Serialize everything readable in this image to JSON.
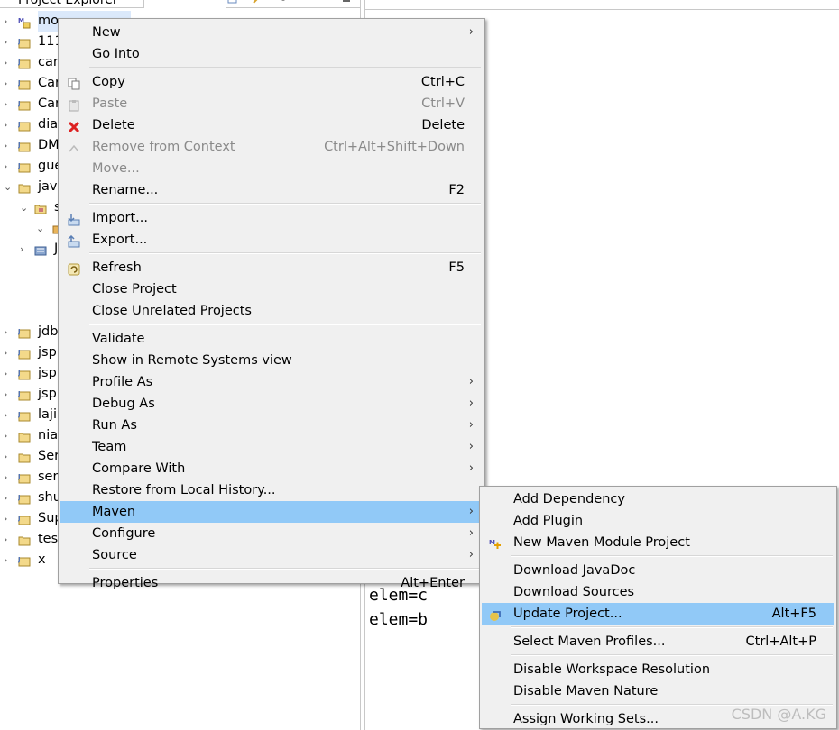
{
  "explorer": {
    "tab_title": "Project Explorer",
    "rows": [
      {
        "label": "mo",
        "twisty": "›",
        "icon": "maven-project-icon",
        "selected": true
      },
      {
        "label": "111",
        "twisty": "›",
        "icon": "java-project-icon"
      },
      {
        "label": "car",
        "twisty": "›",
        "icon": "java-project-icon"
      },
      {
        "label": "Car",
        "twisty": "›",
        "icon": "java-project-icon"
      },
      {
        "label": "Car",
        "twisty": "›",
        "icon": "java-project-icon"
      },
      {
        "label": "dia",
        "twisty": "›",
        "icon": "java-project-icon"
      },
      {
        "label": "DM",
        "twisty": "›",
        "icon": "java-project-icon"
      },
      {
        "label": "gue",
        "twisty": "›",
        "icon": "java-project-icon"
      },
      {
        "label": "java",
        "twisty": "⌄",
        "icon": "folder-icon"
      },
      {
        "label": "s",
        "twisty": "⌄",
        "icon": "package-folder-icon",
        "indent": 1
      },
      {
        "label": "",
        "twisty": "⌄",
        "icon": "package-icon",
        "indent": 2
      },
      {
        "label": "J",
        "twisty": "›",
        "icon": "library-icon",
        "indent": 1
      },
      {
        "label": "jdb",
        "twisty": "›",
        "icon": "java-project-icon"
      },
      {
        "label": "jsp",
        "twisty": "›",
        "icon": "java-project-icon"
      },
      {
        "label": "jsp",
        "twisty": "›",
        "icon": "java-project-icon"
      },
      {
        "label": "jsp",
        "twisty": "›",
        "icon": "java-project-icon"
      },
      {
        "label": "laji",
        "twisty": "›",
        "icon": "java-project-icon"
      },
      {
        "label": "nia",
        "twisty": "›",
        "icon": "folder-icon"
      },
      {
        "label": "Ser",
        "twisty": "›",
        "icon": "folder-icon"
      },
      {
        "label": "ser",
        "twisty": "›",
        "icon": "java-project-icon"
      },
      {
        "label": "shu",
        "twisty": "›",
        "icon": "java-project-icon"
      },
      {
        "label": "Sup",
        "twisty": "›",
        "icon": "java-project-icon"
      },
      {
        "label": "tes",
        "twisty": "›",
        "icon": "folder-icon"
      },
      {
        "label": "x",
        "twisty": "›",
        "icon": "java-project-icon"
      }
    ]
  },
  "console": {
    "lines": [
      "elem=c",
      "elem=b"
    ]
  },
  "context_menu": {
    "items": [
      {
        "label": "New",
        "submenu": true
      },
      {
        "label": "Go Into"
      },
      {
        "sep": true
      },
      {
        "label": "Copy",
        "accel": "Ctrl+C",
        "icon": "copy-icon"
      },
      {
        "label": "Paste",
        "accel": "Ctrl+V",
        "icon": "paste-icon",
        "disabled": true
      },
      {
        "label": "Delete",
        "accel": "Delete",
        "icon": "delete-icon"
      },
      {
        "label": "Remove from Context",
        "accel": "Ctrl+Alt+Shift+Down",
        "icon": "remove-context-icon",
        "disabled": true
      },
      {
        "label": "Move...",
        "disabled": true
      },
      {
        "label": "Rename...",
        "accel": "F2"
      },
      {
        "sep": true
      },
      {
        "label": "Import...",
        "icon": "import-icon"
      },
      {
        "label": "Export...",
        "icon": "export-icon"
      },
      {
        "sep": true
      },
      {
        "label": "Refresh",
        "accel": "F5",
        "icon": "refresh-icon"
      },
      {
        "label": "Close Project"
      },
      {
        "label": "Close Unrelated Projects"
      },
      {
        "sep": true
      },
      {
        "label": "Validate"
      },
      {
        "label": "Show in Remote Systems view"
      },
      {
        "label": "Profile As",
        "submenu": true
      },
      {
        "label": "Debug As",
        "submenu": true
      },
      {
        "label": "Run As",
        "submenu": true
      },
      {
        "label": "Team",
        "submenu": true
      },
      {
        "label": "Compare With",
        "submenu": true
      },
      {
        "label": "Restore from Local History..."
      },
      {
        "label": "Maven",
        "submenu": true,
        "highlighted": true
      },
      {
        "label": "Configure",
        "submenu": true
      },
      {
        "label": "Source",
        "submenu": true
      },
      {
        "sep": true
      },
      {
        "label": "Properties",
        "accel": "Alt+Enter"
      }
    ]
  },
  "maven_submenu": {
    "items": [
      {
        "label": "Add Dependency"
      },
      {
        "label": "Add Plugin"
      },
      {
        "label": "New Maven Module Project",
        "icon": "maven-module-icon"
      },
      {
        "sep": true
      },
      {
        "label": "Download JavaDoc"
      },
      {
        "label": "Download Sources"
      },
      {
        "label": "Update Project...",
        "accel": "Alt+F5",
        "icon": "update-project-icon",
        "highlighted": true
      },
      {
        "sep": true
      },
      {
        "label": "Select Maven Profiles...",
        "accel": "Ctrl+Alt+P"
      },
      {
        "sep": true
      },
      {
        "label": "Disable Workspace Resolution"
      },
      {
        "label": "Disable Maven Nature"
      },
      {
        "sep": true
      },
      {
        "label": "Assign Working Sets..."
      }
    ]
  },
  "watermark": "CSDN @A.KG",
  "colors": {
    "highlight": "#91c9f7",
    "menu_bg": "#f0f0f0",
    "disabled_text": "#8a8a8a"
  }
}
